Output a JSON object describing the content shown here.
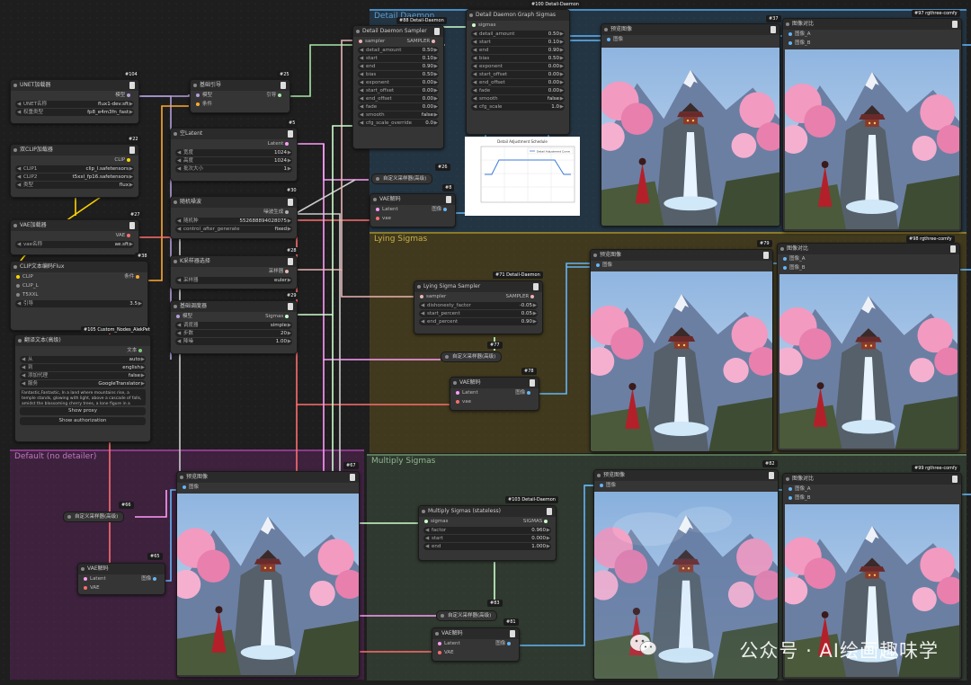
{
  "colors": {
    "model": "#b39ddb",
    "clip": "#ffd500",
    "vae": "#ff6e6e",
    "latent": "#ff9cf9",
    "conditioning": "#ffa931",
    "image": "#64b5f6",
    "sampler": "#ecb4b4",
    "sigmas": "#cdffcd",
    "noise": "#b0b0b0"
  },
  "groups": {
    "detail_daemon": {
      "title": "Detail Daemon",
      "badge": "#100 Detail-Daemon"
    },
    "lying": {
      "title": "Lying Sigmas"
    },
    "default": {
      "title": "Default (no detailer)"
    },
    "multiply": {
      "title": "Multiply Sigmas"
    }
  },
  "nodes": {
    "unet": {
      "id": "#104",
      "title": "UNET加载器",
      "out": "模型",
      "w1_label": "UNET名称",
      "w1_value": "flux1-dev.sft",
      "w2_label": "权重类型",
      "w2_value": "fp8_e4m3fn_fast"
    },
    "dualclip": {
      "id": "#22",
      "title": "双CLIP加载器",
      "out": "CLIP",
      "w1_label": "CLIP1",
      "w1_value": "clip_l.safetensors",
      "w2_label": "CLIP2",
      "w2_value": "t5xxl_fp16.safetensors",
      "w3_label": "类型",
      "w3_value": "flux"
    },
    "vaeload": {
      "id": "#27",
      "title": "VAE加载器",
      "out": "VAE",
      "w1_label": "vae名称",
      "w1_value": "ae.sft"
    },
    "clipenc": {
      "id": "#38",
      "title": "CLIP文本编码Flux",
      "in1": "CLIP",
      "in2": "CLIP_L",
      "in3": "T5XXL",
      "out": "条件",
      "w1_label": "引导",
      "w1_value": "3.5"
    },
    "translate": {
      "id": "#105 Custom_Nodes_AlekPet",
      "title": "翻译文本(高级)",
      "out": "文本",
      "w1_label": "从",
      "w1_value": "auto",
      "w2_label": "到",
      "w2_value": "english",
      "w3_label": "添加代理",
      "w3_value": "false",
      "w4_label": "服务",
      "w4_value": "GoogleTranslator",
      "text": "Fantastic,Fantastic, In a land where mountains rise, a temple stands, glowing with light, above a cascade of falls, amidst the blossoming cherry trees, a lone figure in a crimson cloak",
      "btn1": "Show proxy",
      "btn2": "Show authorization"
    },
    "guider": {
      "id": "#25",
      "title": "基础引导",
      "in1": "模型",
      "in2": "条件",
      "out": "引导"
    },
    "emptylatent": {
      "id": "#5",
      "title": "空Latent",
      "out": "Latent",
      "w1_label": "宽度",
      "w1_value": "1024",
      "w2_label": "高度",
      "w2_value": "1024",
      "w3_label": "批次大小",
      "w3_value": "1"
    },
    "noise": {
      "id": "#30",
      "title": "随机噪波",
      "out": "噪波生成",
      "w1_label": "随机种",
      "w1_value": "552688894028075",
      "w2_label": "control_after_generate",
      "w2_value": "fixed"
    },
    "ksampler_sel": {
      "id": "#28",
      "title": "K采样器选择",
      "out": "采样器",
      "w1_label": "采样器",
      "w1_value": "euler"
    },
    "scheduler": {
      "id": "#29",
      "title": "基础调度器",
      "in1": "模型",
      "out": "Sigmas",
      "w1_label": "调度器",
      "w1_value": "simple",
      "w2_label": "步数",
      "w2_value": "20",
      "w3_label": "降噪",
      "w3_value": "1.00"
    },
    "dd_sampler": {
      "id": "#88 Detail-Daemon",
      "title": "Detail Daemon Sampler",
      "in1": "sampler",
      "out": "SAMPLER",
      "widgets": [
        [
          "detail_amount",
          "0.50"
        ],
        [
          "start",
          "0.10"
        ],
        [
          "end",
          "0.90"
        ],
        [
          "bias",
          "0.50"
        ],
        [
          "exponent",
          "0.00"
        ],
        [
          "start_offset",
          "0.00"
        ],
        [
          "end_offset",
          "0.00"
        ],
        [
          "fade",
          "0.00"
        ],
        [
          "smooth",
          "false"
        ],
        [
          "cfg_scale_override",
          "0.0"
        ]
      ]
    },
    "dd_graph": {
      "title": "Detail Daemon Graph Sigmas",
      "in1": "sigmas",
      "widgets": [
        [
          "detail_amount",
          "0.50"
        ],
        [
          "start",
          "0.10"
        ],
        [
          "end",
          "0.90"
        ],
        [
          "bias",
          "0.50"
        ],
        [
          "exponent",
          "0.00"
        ],
        [
          "start_offset",
          "0.00"
        ],
        [
          "end_offset",
          "0.00"
        ],
        [
          "fade",
          "0.00"
        ],
        [
          "smooth",
          "false"
        ],
        [
          "cfg_scale",
          "1.0"
        ]
      ]
    },
    "dd_custom": {
      "id": "#26",
      "title": "自定义采样器(高级)"
    },
    "dd_vaedecode": {
      "id": "#8",
      "title": "VAE解码",
      "in1": "Latent",
      "in2": "vae",
      "out": "图像"
    },
    "dd_preview": {
      "id": "#37",
      "title": "预览图像",
      "in1": "图像"
    },
    "dd_compare": {
      "id": "#97 rgthree-comfy",
      "title": "图像对比",
      "in1": "图像_A",
      "in2": "图像_B"
    },
    "lying_sampler": {
      "id": "#71 Detail-Daemon",
      "title": "Lying Sigma Sampler",
      "in1": "sampler",
      "out": "SAMPLER",
      "widgets": [
        [
          "dishonesty_factor",
          "-0.05"
        ],
        [
          "start_percent",
          "0.05"
        ],
        [
          "end_percent",
          "0.90"
        ]
      ]
    },
    "lying_custom": {
      "id": "#77",
      "title": "自定义采样器(高级)"
    },
    "lying_vaedecode": {
      "id": "#78",
      "title": "VAE解码",
      "in1": "Latent",
      "in2": "vae",
      "out": "图像"
    },
    "lying_preview": {
      "id": "#79",
      "title": "预览图像",
      "in1": "图像"
    },
    "lying_compare": {
      "id": "#98 rgthree-comfy",
      "title": "图像对比",
      "in1": "图像_A",
      "in2": "图像_B"
    },
    "def_custom": {
      "id": "#66",
      "title": "自定义采样器(高级)"
    },
    "def_vaedecode": {
      "id": "#65",
      "title": "VAE解码",
      "in1": "Latent",
      "in2": "VAE",
      "out": "图像"
    },
    "def_preview": {
      "id": "#67",
      "title": "预览图像",
      "in1": "图像"
    },
    "mul_sigmas": {
      "id": "#103 Detail-Daemon",
      "title": "Multiply Sigmas (stateless)",
      "in1": "sigmas",
      "out": "SIGMAS",
      "widgets": [
        [
          "factor",
          "0.960"
        ],
        [
          "start",
          "0.000"
        ],
        [
          "end",
          "1.000"
        ]
      ]
    },
    "mul_custom": {
      "id": "#83",
      "title": "自定义采样器(高级)"
    },
    "mul_vaedecode": {
      "id": "#81",
      "title": "VAE解码",
      "in1": "Latent",
      "in2": "VAE",
      "out": "图像"
    },
    "mul_preview": {
      "id": "#82",
      "title": "预览图像",
      "in1": "图像"
    },
    "mul_compare": {
      "id": "#99 rgthree-comfy",
      "title": "图像对比",
      "in1": "图像_A",
      "in2": "图像_B"
    }
  },
  "plot": {
    "title": "Detail Adjustment Schedule",
    "legend": "Detail Adjustment Curve"
  },
  "watermark": {
    "text": "公众号 · AI绘画趣味学"
  }
}
